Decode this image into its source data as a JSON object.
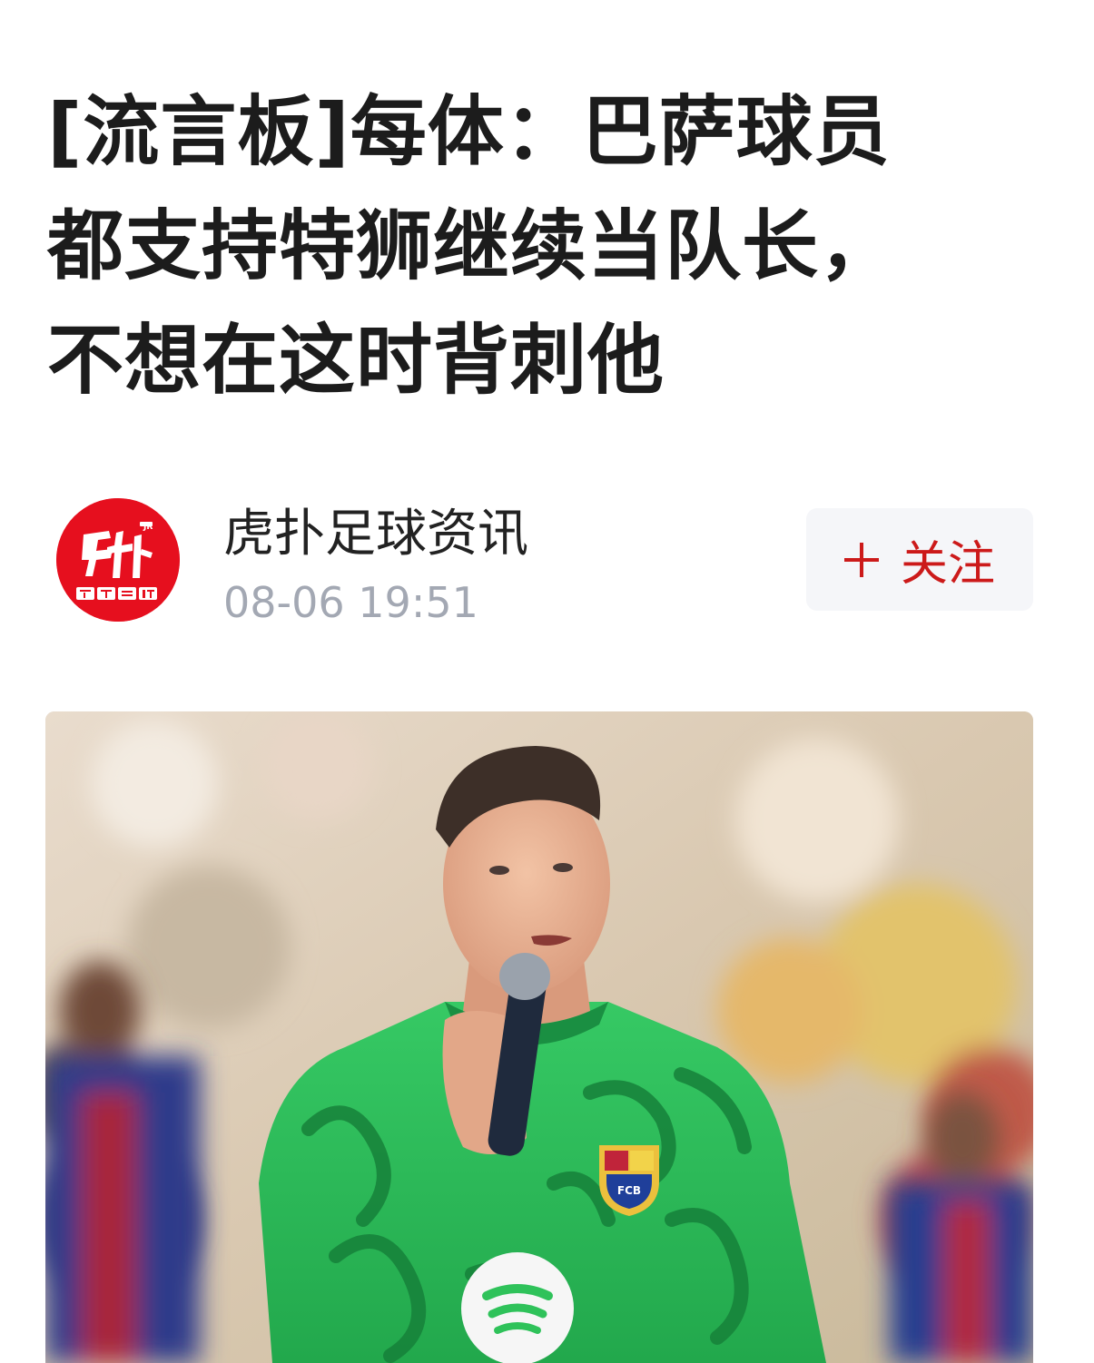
{
  "article": {
    "title_lines": [
      "[流言板]每体：巴萨球员",
      "都支持特狮继续当队长，",
      "不想在这时背刺他"
    ]
  },
  "author": {
    "name": "虎扑足球资讯",
    "time": "08-06 19:51",
    "avatar_logo_text": "虎扑 JR 足球资讯",
    "follow_label": "关注"
  },
  "colors": {
    "brand_red": "#e60f1e",
    "follow_text": "#cc1a1a",
    "time_gray": "#a3a8b3",
    "jersey_green": "#2fc25a"
  },
  "icons": {
    "follow": "plus-icon",
    "avatar": "hupu-football-logo"
  },
  "hero_image": {
    "subject": "goalkeeper in green Barcelona jersey speaking into microphone",
    "jersey_badge_text": "FCB"
  }
}
